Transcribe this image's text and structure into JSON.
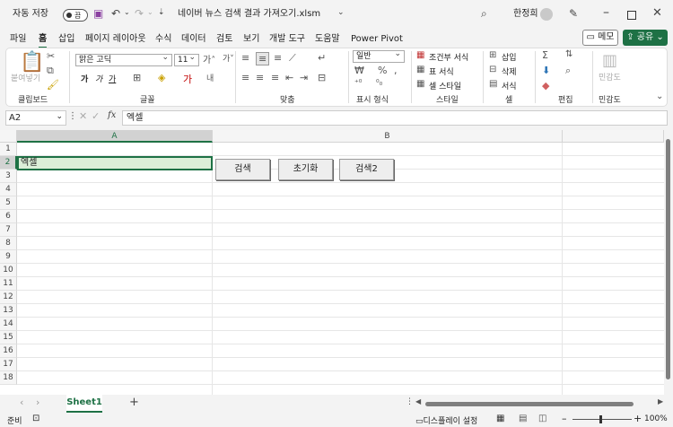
{
  "titlebar": {
    "autosave_label": "자동 저장",
    "autosave_state": "끔",
    "filename": "네이버 뉴스 검색 결과 가져오기.xlsm",
    "user_name": "한정희",
    "icons": [
      "save-icon",
      "undo-icon",
      "redo-icon",
      "customize-icon",
      "search-icon",
      "avatar",
      "pen-icon",
      "minimize-icon",
      "maximize-icon",
      "close-icon"
    ]
  },
  "ribbon_tabs": [
    "파일",
    "홈",
    "삽입",
    "페이지 레이아웃",
    "수식",
    "데이터",
    "검토",
    "보기",
    "개발 도구",
    "도움말",
    "Power Pivot"
  ],
  "active_tab": "홈",
  "ribbon_buttons": {
    "memo": "메모",
    "share": "공유"
  },
  "ribbon": {
    "clipboard": {
      "label": "클립보드",
      "paste": "붙여넣기"
    },
    "font": {
      "label": "글꼴",
      "font_name": "맑은 고딕",
      "font_size": "11",
      "bold": "가",
      "italic": "가",
      "underline": "가"
    },
    "alignment": {
      "label": "맞춤"
    },
    "number": {
      "label": "표시 형식",
      "format": "일반"
    },
    "styles": {
      "label": "스타일",
      "conditional": "조건부 서식",
      "table": "표 서식",
      "cell": "셀 스타일"
    },
    "cells": {
      "label": "셀",
      "insert": "삽입",
      "delete": "삭제",
      "format": "서식"
    },
    "editing": {
      "label": "편집"
    },
    "sensitivity": {
      "label": "민감도",
      "button": "민감도"
    }
  },
  "formula_bar": {
    "name_box": "A2",
    "fx": "fx",
    "content": "엑셀"
  },
  "grid": {
    "columns": [
      "A",
      "B"
    ],
    "rows": [
      "1",
      "2",
      "3",
      "4",
      "5",
      "6",
      "7",
      "8",
      "9",
      "10",
      "11",
      "12",
      "13",
      "14",
      "15",
      "16",
      "17",
      "18"
    ],
    "cell_A2": "엑셀",
    "buttons": [
      "검색",
      "초기화",
      "검색2"
    ]
  },
  "sheets": {
    "active": "Sheet1",
    "add": "+"
  },
  "status": {
    "ready": "준비",
    "display_settings": "디스플레이 설정",
    "zoom": "100%"
  }
}
